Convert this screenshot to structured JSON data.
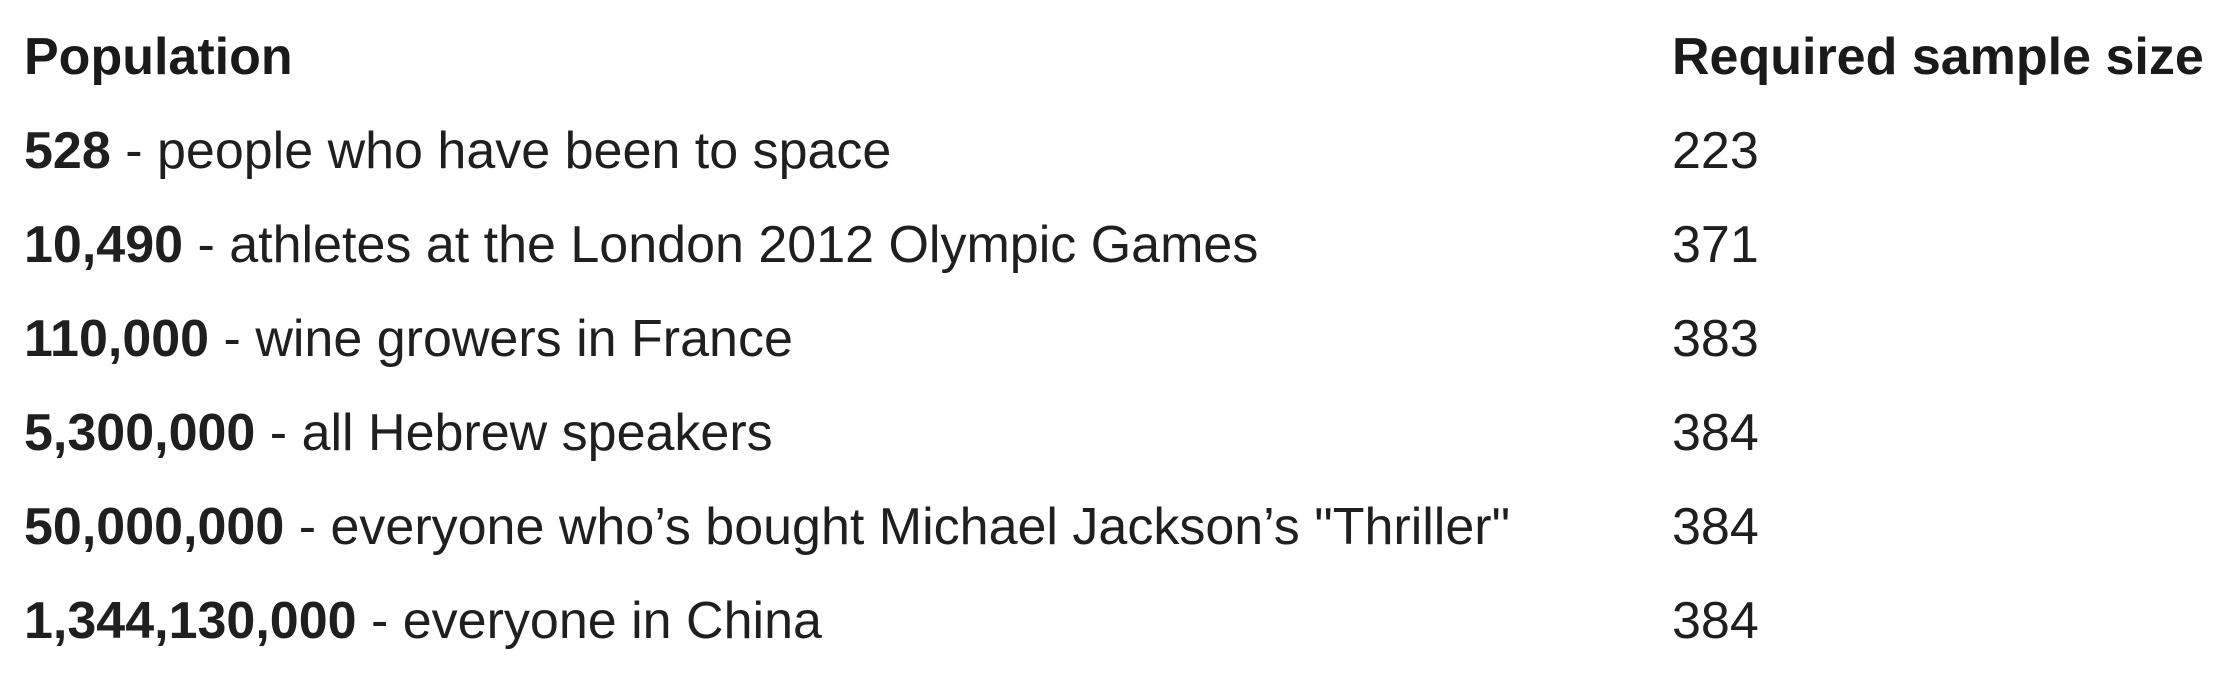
{
  "table": {
    "headers": {
      "population": "Population",
      "sample_size": "Required sample size"
    },
    "separator": " - ",
    "rows": [
      {
        "count": "528",
        "description": "people who have been to space",
        "sample_size": "223"
      },
      {
        "count": "10,490",
        "description": "athletes at the London 2012 Olympic Games",
        "sample_size": "371"
      },
      {
        "count": "110,000",
        "description": "wine growers in France",
        "sample_size": "383"
      },
      {
        "count": "5,300,000",
        "description": "all Hebrew speakers",
        "sample_size": "384"
      },
      {
        "count": "50,000,000",
        "description": "everyone who’s bought Michael Jackson’s \"Thriller\"",
        "sample_size": "384"
      },
      {
        "count": "1,344,130,000",
        "description": "everyone in China",
        "sample_size": "384"
      }
    ]
  }
}
